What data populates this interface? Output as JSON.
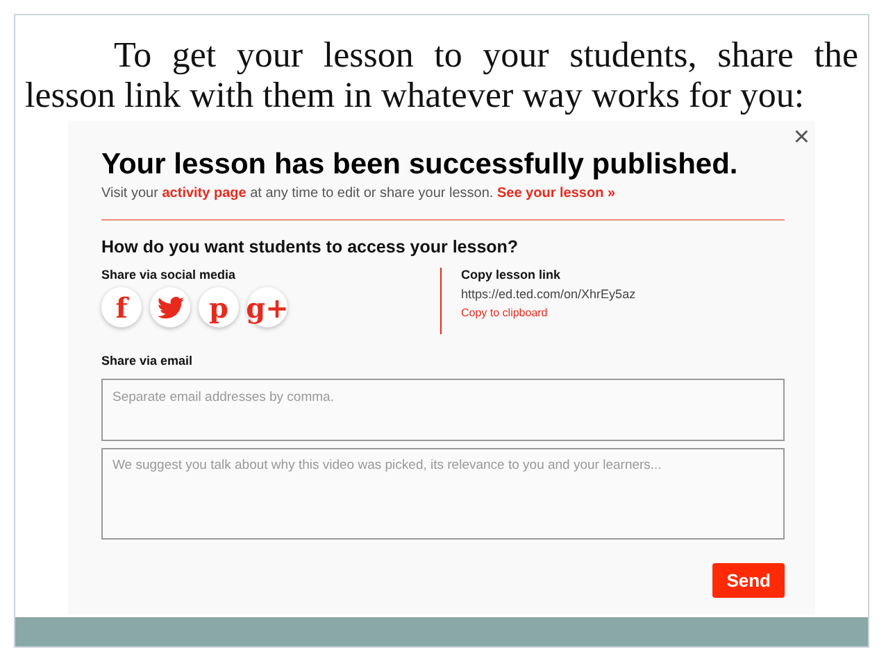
{
  "slide": {
    "paragraph": "To get your lesson to your students, share the lesson link with them in whatever way works for you:"
  },
  "dialog": {
    "close": "×",
    "title": "Your lesson has been successfully published.",
    "subtitle": [
      {
        "kind": "text",
        "text": "Visit your "
      },
      {
        "kind": "link",
        "text": "activity page"
      },
      {
        "kind": "text",
        "text": " at any time to edit or share your lesson. "
      },
      {
        "kind": "link",
        "text": "See your lesson »"
      }
    ],
    "question": "How do you want students to access your lesson?",
    "social": {
      "label": "Share via social media",
      "buttons": [
        {
          "kind": "letter",
          "text": "f"
        },
        {
          "kind": "bird"
        },
        {
          "kind": "letter",
          "text": "p"
        },
        {
          "kind": "letter",
          "text": "g+"
        }
      ]
    },
    "link": {
      "label": "Copy lesson link",
      "url": "https://ed.ted.com/on/XhrEy5az",
      "copy": "Copy to clipboard"
    },
    "email": {
      "label": "Share via email",
      "to_placeholder": "Separate email addresses by comma.",
      "message_placeholder": "We suggest you talk about why this video was picked, its relevance to you and your learners..."
    },
    "send": "Send"
  }
}
